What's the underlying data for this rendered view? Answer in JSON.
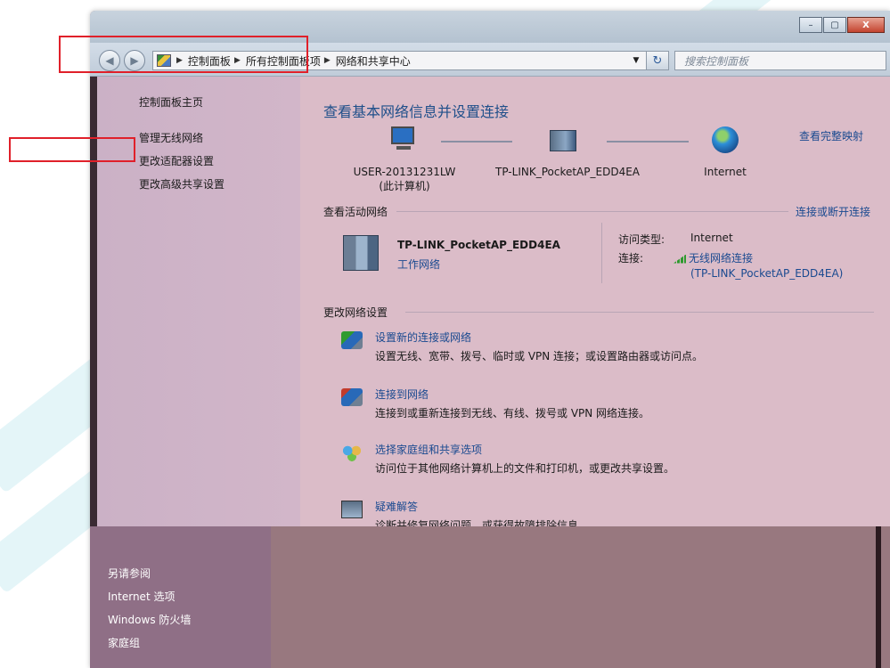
{
  "window": {
    "caption_buttons": [
      "–",
      "▢",
      "X"
    ]
  },
  "navigation": {
    "breadcrumb": [
      "控制面板",
      "所有控制面板项",
      "网络和共享中心"
    ],
    "search_placeholder": "搜索控制面板"
  },
  "sidebar": {
    "items": [
      {
        "label": "控制面板主页"
      },
      {
        "label": "管理无线网络"
      },
      {
        "label": "更改适配器设置"
      },
      {
        "label": "更改高级共享设置"
      }
    ],
    "see_also_title": "另请参阅",
    "see_also": [
      {
        "label": "Internet 选项"
      },
      {
        "label": "Windows 防火墙"
      },
      {
        "label": "家庭组"
      }
    ]
  },
  "main": {
    "title": "查看基本网络信息并设置连接",
    "view_full_map": "查看完整映射",
    "nodes": [
      {
        "name": "USER-20131231LW",
        "sub": "(此计算机)",
        "icon": "computer-icon"
      },
      {
        "name": "TP-LINK_PocketAP_EDD4EA",
        "sub": "",
        "icon": "router-icon"
      },
      {
        "name": "Internet",
        "sub": "",
        "icon": "globe-icon"
      }
    ],
    "active_networks": {
      "title": "查看活动网络",
      "action": "连接或断开连接",
      "network_name": "TP-LINK_PocketAP_EDD4EA",
      "network_type": "工作网络",
      "access_type_label": "访问类型:",
      "access_type_value": "Internet",
      "connection_label": "连接:",
      "connection_value": "无线网络连接",
      "connection_detail": "(TP-LINK_PocketAP_EDD4EA)"
    },
    "change_settings": {
      "title": "更改网络设置",
      "tasks": [
        {
          "label": "设置新的连接或网络",
          "desc": "设置无线、宽带、拨号、临时或 VPN 连接；或设置路由器或访问点。",
          "icon": "network-setup-icon"
        },
        {
          "label": "连接到网络",
          "desc": "连接到或重新连接到无线、有线、拨号或 VPN 网络连接。",
          "icon": "connect-network-icon"
        },
        {
          "label": "选择家庭组和共享选项",
          "desc": "访问位于其他网络计算机上的文件和打印机，或更改共享设置。",
          "icon": "homegroup-icon"
        },
        {
          "label": "疑难解答",
          "desc": "诊断并修复网络问题，或获得故障排除信息。",
          "icon": "troubleshoot-icon"
        }
      ]
    }
  }
}
